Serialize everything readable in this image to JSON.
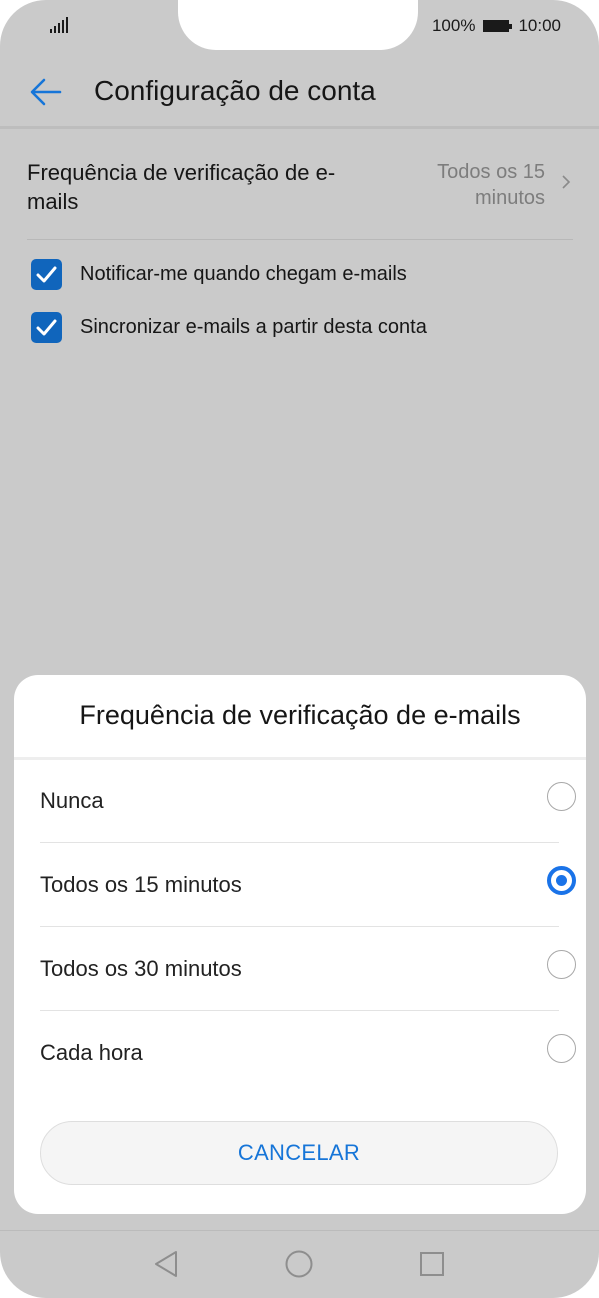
{
  "status_bar": {
    "battery_text": "100%",
    "time": "10:00",
    "icons": [
      "signal-icon",
      "battery-icon"
    ]
  },
  "app_bar": {
    "title": "Configuração de conta",
    "back_icon": "back-arrow-icon"
  },
  "settings": {
    "frequency": {
      "label": "Frequência de verificação de e-mails",
      "value": "Todos os 15 minutos"
    },
    "notify": {
      "label": "Notificar-me quando chegam e-mails",
      "checked": true
    },
    "sync": {
      "label": "Sincronizar e-mails a partir desta conta",
      "checked": true
    }
  },
  "dialog": {
    "title": "Frequência de verificação de e-mails",
    "options": [
      {
        "label": "Nunca",
        "selected": false
      },
      {
        "label": "Todos os 15 minutos",
        "selected": true
      },
      {
        "label": "Todos os 30 minutos",
        "selected": false
      },
      {
        "label": "Cada hora",
        "selected": false
      }
    ],
    "cancel_label": "CANCELAR"
  },
  "colors": {
    "accent": "#1a73e8",
    "checkbox": "#1065bc",
    "scrim_background": "#cacaca"
  },
  "nav_bar": {
    "icons": [
      "back-triangle-icon",
      "home-circle-icon",
      "recents-square-icon"
    ]
  }
}
